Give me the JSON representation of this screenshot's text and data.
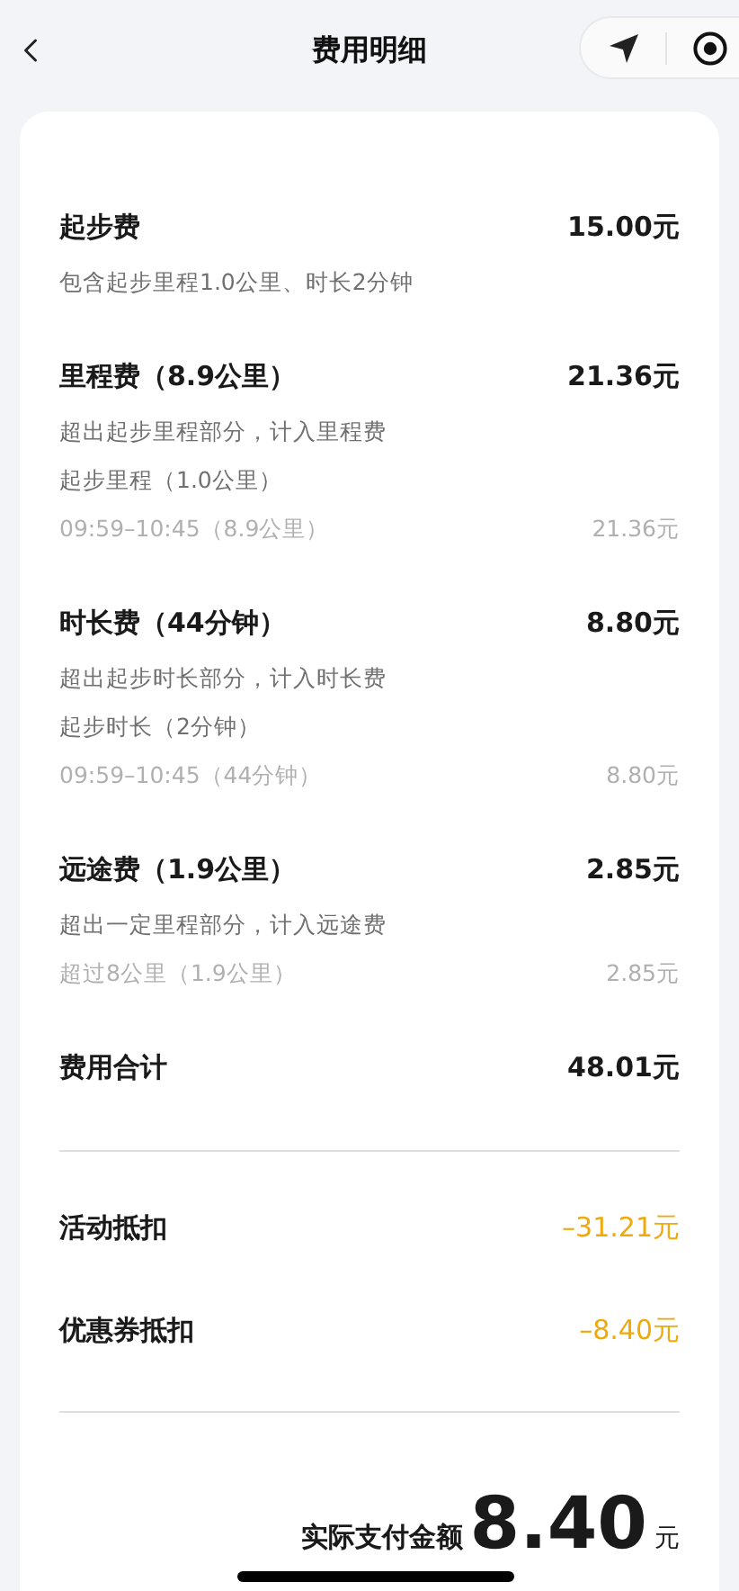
{
  "header": {
    "title": "费用明细"
  },
  "fees": [
    {
      "title": "起步费",
      "amount": "15.00元",
      "lines": [
        {
          "kind": "note",
          "text": "包含起步里程1.0公里、时长2分钟"
        }
      ]
    },
    {
      "title": "里程费（8.9公里）",
      "amount": "21.36元",
      "lines": [
        {
          "kind": "note",
          "text": "超出起步里程部分，计入里程费"
        },
        {
          "kind": "note",
          "text": "起步里程（1.0公里）"
        },
        {
          "kind": "detail",
          "text": "09:59–10:45（8.9公里）",
          "amount": "21.36元"
        }
      ]
    },
    {
      "title": "时长费（44分钟）",
      "amount": "8.80元",
      "lines": [
        {
          "kind": "note",
          "text": "超出起步时长部分，计入时长费"
        },
        {
          "kind": "note",
          "text": "起步时长（2分钟）"
        },
        {
          "kind": "detail",
          "text": "09:59–10:45（44分钟）",
          "amount": "8.80元"
        }
      ]
    },
    {
      "title": "远途费（1.9公里）",
      "amount": "2.85元",
      "lines": [
        {
          "kind": "note",
          "text": "超出一定里程部分，计入远途费"
        },
        {
          "kind": "detail",
          "text": "超过8公里（1.9公里）",
          "amount": "2.85元"
        }
      ]
    },
    {
      "title": "费用合计",
      "amount": "48.01元"
    }
  ],
  "discounts": [
    {
      "title": "活动抵扣",
      "amount": "–31.21元"
    },
    {
      "title": "优惠券抵扣",
      "amount": "–8.40元"
    }
  ],
  "payment": {
    "label": "实际支付金额",
    "amount": "8.40",
    "unit": "元"
  }
}
